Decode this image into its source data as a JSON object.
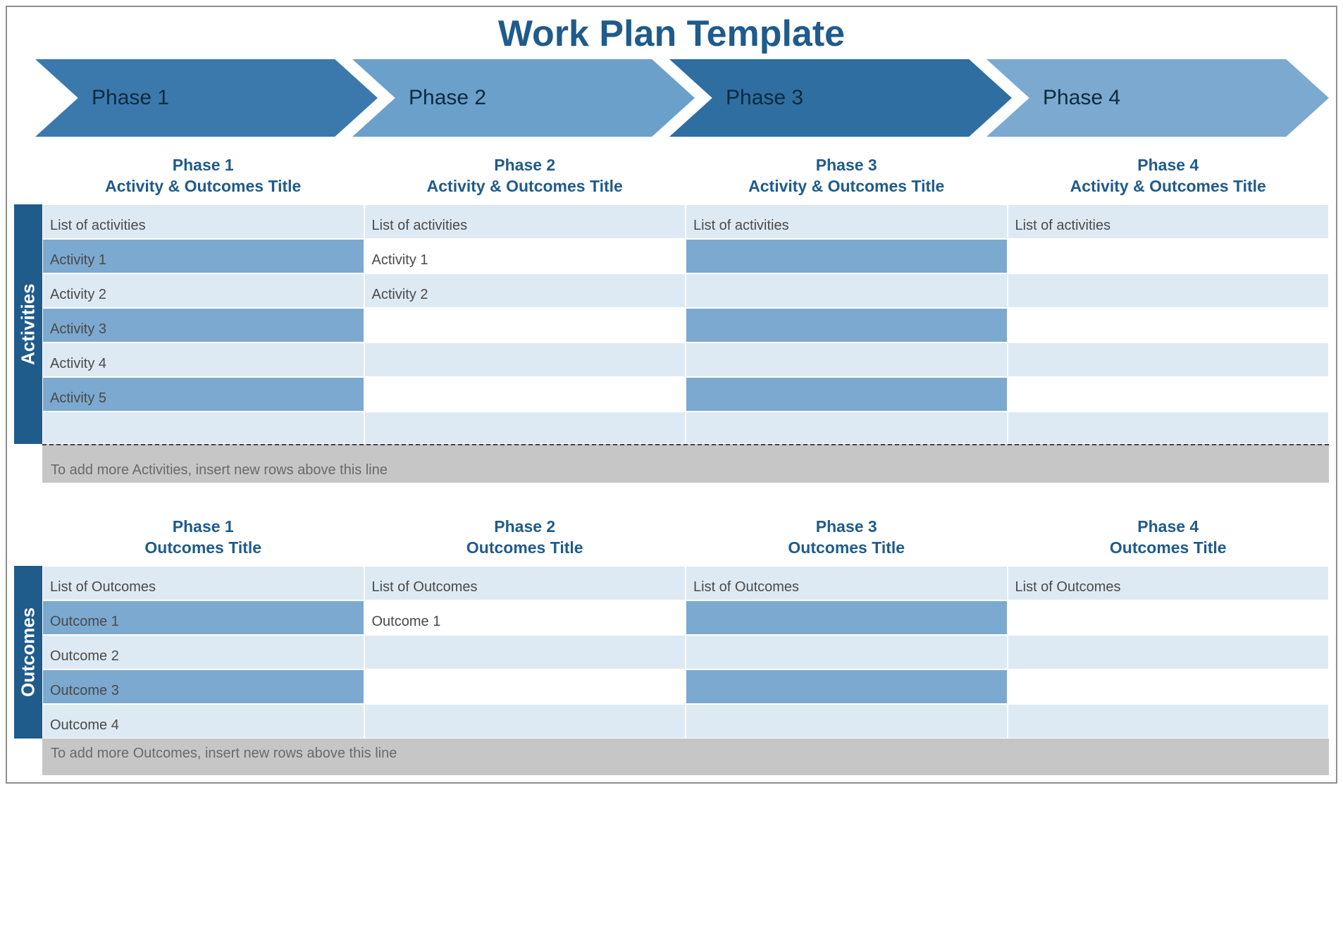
{
  "title": "Work Plan Template",
  "phases": [
    {
      "name": "Phase 1",
      "color": "#3b79ad"
    },
    {
      "name": "Phase 2",
      "color": "#6ba0cb"
    },
    {
      "name": "Phase 3",
      "color": "#2f6ea1"
    },
    {
      "name": "Phase 4",
      "color": "#7ba9cf"
    }
  ],
  "activities": {
    "sideLabel": "Activities",
    "headers": [
      {
        "phase": "Phase 1",
        "sub": "Activity & Outcomes Title"
      },
      {
        "phase": "Phase 2",
        "sub": "Activity & Outcomes Title"
      },
      {
        "phase": "Phase 3",
        "sub": "Activity & Outcomes Title"
      },
      {
        "phase": "Phase 4",
        "sub": "Activity & Outcomes Title"
      }
    ],
    "rows": [
      {
        "cells": [
          "List of activities",
          "List of activities",
          "List of activities",
          "List of activities"
        ],
        "styles": [
          "light",
          "light",
          "light",
          "light"
        ]
      },
      {
        "cells": [
          "Activity 1",
          "Activity 1",
          "",
          ""
        ],
        "styles": [
          "mid",
          "white",
          "mid",
          "white"
        ]
      },
      {
        "cells": [
          "Activity 2",
          "Activity 2",
          "",
          ""
        ],
        "styles": [
          "light",
          "light",
          "light",
          "light"
        ]
      },
      {
        "cells": [
          "Activity 3",
          "",
          "",
          ""
        ],
        "styles": [
          "mid",
          "white",
          "mid",
          "white"
        ]
      },
      {
        "cells": [
          "Activity 4",
          "",
          "",
          ""
        ],
        "styles": [
          "light",
          "light",
          "light",
          "light"
        ]
      },
      {
        "cells": [
          "Activity 5",
          "",
          "",
          ""
        ],
        "styles": [
          "mid",
          "white",
          "mid",
          "white"
        ]
      },
      {
        "cells": [
          "",
          "",
          "",
          ""
        ],
        "styles": [
          "light",
          "light",
          "light",
          "light"
        ]
      }
    ],
    "note": "To add more Activities, insert new rows above this line"
  },
  "outcomes": {
    "sideLabel": "Outcomes",
    "headers": [
      {
        "phase": "Phase 1",
        "sub": "Outcomes Title"
      },
      {
        "phase": "Phase 2",
        "sub": "Outcomes Title"
      },
      {
        "phase": "Phase 3",
        "sub": "Outcomes Title"
      },
      {
        "phase": "Phase 4",
        "sub": "Outcomes Title"
      }
    ],
    "rows": [
      {
        "cells": [
          "List of Outcomes",
          "List of Outcomes",
          "List of Outcomes",
          "List of Outcomes"
        ],
        "styles": [
          "light",
          "light",
          "light",
          "light"
        ]
      },
      {
        "cells": [
          "Outcome 1",
          "Outcome 1",
          "",
          ""
        ],
        "styles": [
          "mid",
          "white",
          "mid",
          "white"
        ]
      },
      {
        "cells": [
          "Outcome 2",
          "",
          "",
          ""
        ],
        "styles": [
          "light",
          "light",
          "light",
          "light"
        ]
      },
      {
        "cells": [
          "Outcome 3",
          "",
          "",
          ""
        ],
        "styles": [
          "mid",
          "white",
          "mid",
          "white"
        ]
      },
      {
        "cells": [
          "Outcome 4",
          "",
          "",
          ""
        ],
        "styles": [
          "light",
          "light",
          "light",
          "light"
        ]
      }
    ],
    "note": "To add more Outcomes, insert new rows above this line"
  }
}
